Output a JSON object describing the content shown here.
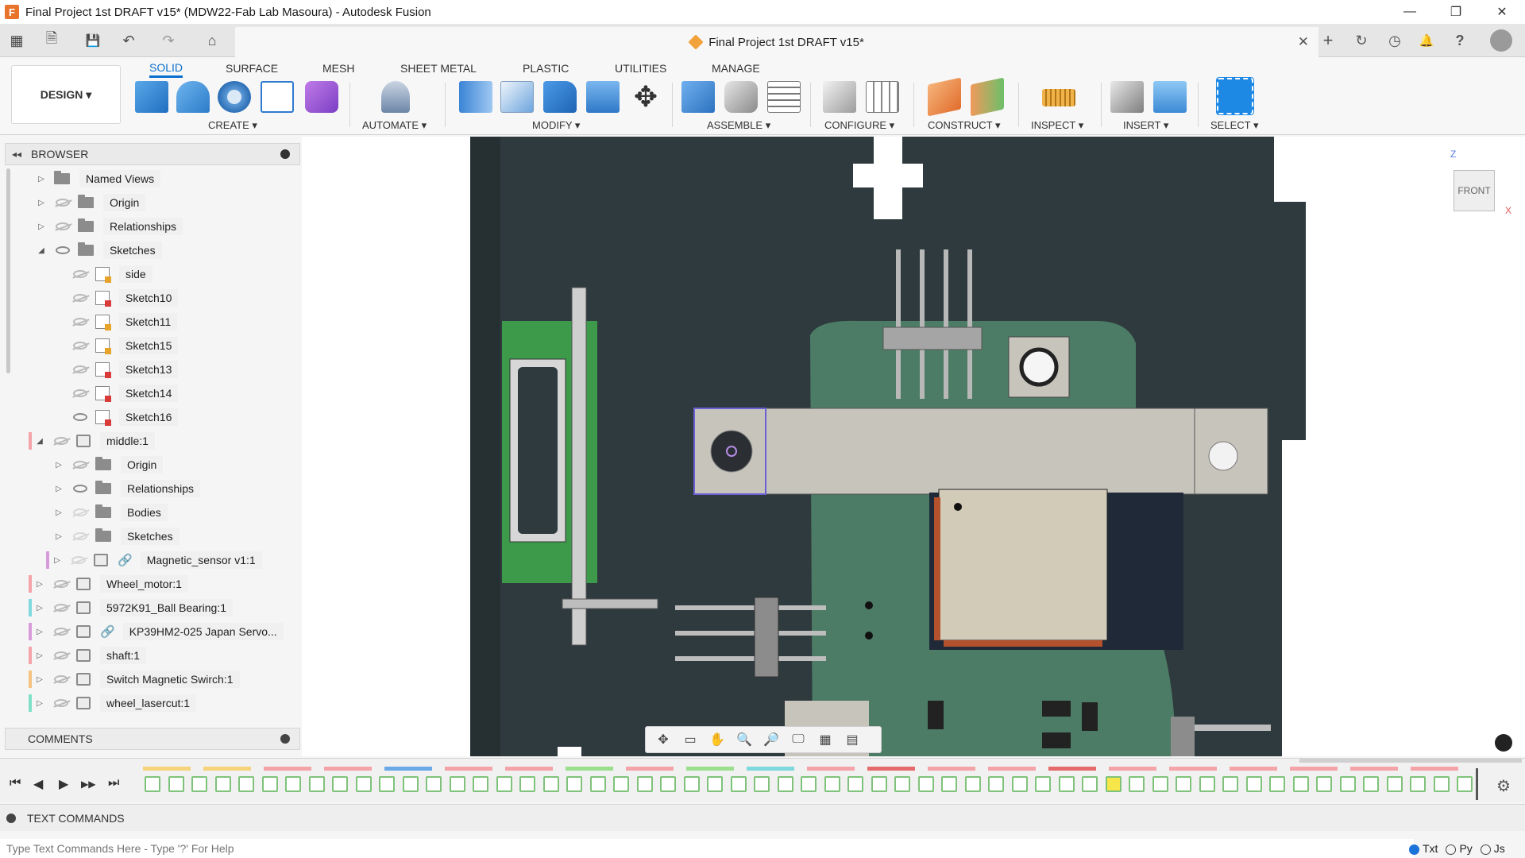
{
  "window": {
    "title": "Final Project 1st DRAFT v15* (MDW22-Fab Lab Masoura) - Autodesk Fusion",
    "controls": [
      "—",
      "❐",
      "✕"
    ]
  },
  "doc_tab": {
    "title": "Final Project 1st DRAFT v15*",
    "close": "✕"
  },
  "quick_access": {
    "home": "⌂",
    "undo": "↶",
    "redo": "↷",
    "save": "💾",
    "file": "🗎",
    "grid": "▦"
  },
  "top_right_icons": {
    "new_tab": "+",
    "extensions": "↻",
    "job_status": "◷",
    "notifications": "🔔",
    "help": "?"
  },
  "ribbon": {
    "workspace": "DESIGN ▾",
    "tabs": [
      "SOLID",
      "SURFACE",
      "MESH",
      "SHEET METAL",
      "PLASTIC",
      "UTILITIES",
      "MANAGE"
    ],
    "active_tab": "SOLID",
    "groups": [
      "CREATE ▾",
      "AUTOMATE ▾",
      "MODIFY ▾",
      "ASSEMBLE ▾",
      "CONFIGURE ▾",
      "CONSTRUCT ▾",
      "INSPECT ▾",
      "INSERT ▾",
      "SELECT ▾"
    ]
  },
  "browser": {
    "title": "BROWSER",
    "items": [
      {
        "label": "Named Views",
        "depth": 0,
        "expand": "▷",
        "eye": "none",
        "type": "folder"
      },
      {
        "label": "Origin",
        "depth": 0,
        "expand": "▷",
        "eye": "off",
        "type": "folder"
      },
      {
        "label": "Relationships",
        "depth": 0,
        "expand": "▷",
        "eye": "off",
        "type": "folder"
      },
      {
        "label": "Sketches",
        "depth": 0,
        "expand": "◢",
        "eye": "on",
        "type": "folder"
      },
      {
        "label": "side",
        "depth": 1,
        "expand": "",
        "eye": "off",
        "type": "sketch-y"
      },
      {
        "label": "Sketch10",
        "depth": 1,
        "expand": "",
        "eye": "off",
        "type": "sketch-r"
      },
      {
        "label": "Sketch11",
        "depth": 1,
        "expand": "",
        "eye": "off",
        "type": "sketch-y"
      },
      {
        "label": "Sketch15",
        "depth": 1,
        "expand": "",
        "eye": "off",
        "type": "sketch-y"
      },
      {
        "label": "Sketch13",
        "depth": 1,
        "expand": "",
        "eye": "off",
        "type": "sketch-r"
      },
      {
        "label": "Sketch14",
        "depth": 1,
        "expand": "",
        "eye": "off",
        "type": "sketch-r"
      },
      {
        "label": "Sketch16",
        "depth": 1,
        "expand": "",
        "eye": "on",
        "type": "sketch-r"
      },
      {
        "label": "middle:1",
        "depth": 0,
        "expand": "◢",
        "eye": "off",
        "type": "comp",
        "color": "#f4a3a8"
      },
      {
        "label": "Origin",
        "depth": 1,
        "expand": "▷",
        "eye": "off",
        "type": "folder"
      },
      {
        "label": "Relationships",
        "depth": 1,
        "expand": "▷",
        "eye": "on",
        "type": "folder"
      },
      {
        "label": "Bodies",
        "depth": 1,
        "expand": "▷",
        "eye": "dim",
        "type": "folder"
      },
      {
        "label": "Sketches",
        "depth": 1,
        "expand": "▷",
        "eye": "dim",
        "type": "folder"
      },
      {
        "label": "Magnetic_sensor v1:1",
        "depth": 1,
        "expand": "▷",
        "eye": "dim",
        "type": "comp-link",
        "color": "#d79bdc"
      },
      {
        "label": "Wheel_motor:1",
        "depth": 0,
        "expand": "▷",
        "eye": "off",
        "type": "body",
        "color": "#f4a3a8"
      },
      {
        "label": "5972K91_Ball Bearing:1",
        "depth": 0,
        "expand": "▷",
        "eye": "off",
        "type": "body",
        "color": "#7fd8dd"
      },
      {
        "label": "KP39HM2-025 Japan Servo...",
        "depth": 0,
        "expand": "▷",
        "eye": "off",
        "type": "comp-link",
        "color": "#d79bdc"
      },
      {
        "label": "shaft:1",
        "depth": 0,
        "expand": "▷",
        "eye": "off",
        "type": "body",
        "color": "#f4a3a8"
      },
      {
        "label": "Switch Magnetic Swirch:1",
        "depth": 0,
        "expand": "▷",
        "eye": "off",
        "type": "body",
        "color": "#f5c27f"
      },
      {
        "label": "wheel_lasercut:1",
        "depth": 0,
        "expand": "▷",
        "eye": "off",
        "type": "body",
        "color": "#7fe0c8"
      }
    ]
  },
  "comments": {
    "title": "COMMENTS"
  },
  "viewcube": {
    "face": "FRONT",
    "z": "Z",
    "x": "X"
  },
  "nav_toolbar": [
    "✥",
    "▭",
    "✋",
    "🔍",
    "🔎",
    "🖵",
    "▦",
    "▤"
  ],
  "timeline": {
    "controls": [
      "⏮",
      "◀",
      "▶",
      "▶▶",
      "⏭"
    ],
    "settings": "⚙"
  },
  "text_commands": {
    "title": "TEXT COMMANDS",
    "placeholder": "Type Text Commands Here - Type '?' For Help",
    "modes": [
      "Txt",
      "Py",
      "Js"
    ],
    "active_mode": "Txt"
  },
  "colors": {
    "accent": "#0a6fcf",
    "pcb_green": "#4c7c65",
    "background_dark": "#2f3a3e",
    "metal": "#c8c5bd"
  }
}
